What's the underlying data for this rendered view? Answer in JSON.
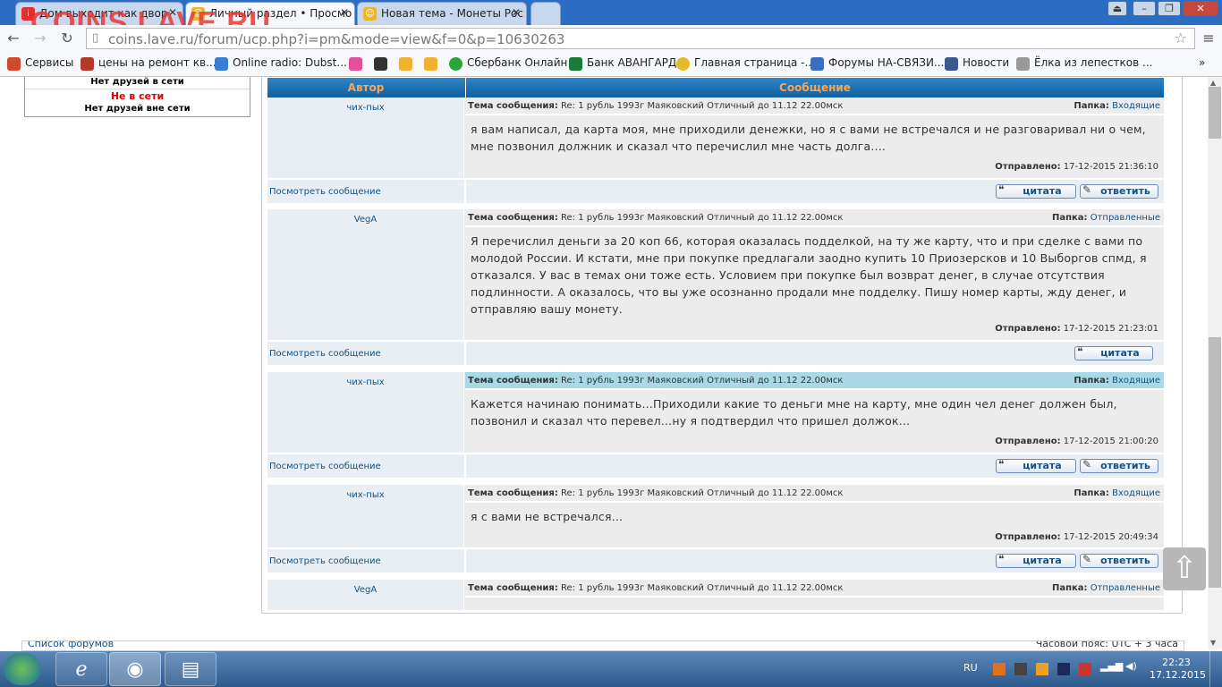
{
  "tabs": [
    {
      "title": "Дом выходит как двор",
      "fav": "i",
      "color": "#e03030"
    },
    {
      "title": "Личный раздел • Просмо",
      "fav": "☺",
      "color": "#e8b82b"
    },
    {
      "title": "Новая тема - Монеты Рос",
      "fav": "☺",
      "color": "#e8b82b"
    }
  ],
  "watermark": "COINS.LAVE.RU",
  "address_bar": {
    "url": "coins.lave.ru/forum/ucp.php?i=pm&mode=view&f=0&p=10630263"
  },
  "bookmarks": [
    {
      "label": "Сервисы",
      "color": "#d04a2a"
    },
    {
      "label": "цены на ремонт кв...",
      "color": "#b43a2a"
    },
    {
      "label": "Online radio: Dubst...",
      "color": "#3a7ed0"
    },
    {
      "label": "",
      "color": "#e34f9a"
    },
    {
      "label": "",
      "color": "#333333"
    },
    {
      "label": "",
      "color": "#f0b030"
    },
    {
      "label": "",
      "color": "#f0b030"
    },
    {
      "label": "Сбербанк Онлайн",
      "color": "#2ba53a"
    },
    {
      "label": "Банк АВАНГАРД",
      "color": "#1a7a3a"
    },
    {
      "label": "Главная страница -...",
      "color": "#e8b82b"
    },
    {
      "label": "Форумы НА-СВЯЗИ...",
      "color": "#3a6ec0"
    },
    {
      "label": "Новости",
      "color": "#3a5a90"
    },
    {
      "label": "Ёлка из лепестков ...",
      "color": "#999999"
    }
  ],
  "friends": {
    "online_none": "Нет друзей в сети",
    "offline_title": "Не в сети",
    "offline_none": "Нет друзей вне сети"
  },
  "table_header": {
    "author": "Автор",
    "message": "Сообщение"
  },
  "messages": [
    {
      "author": "чих-пых",
      "subject_label": "Тема сообщения:",
      "subject": "Re: 1 рубль 1993г Маяковский Отличный до 11.12 22.00мск",
      "folder_label": "Папка:",
      "folder": "Входящие",
      "text": "я вам написал, да карта моя, мне приходили денежки, но я с вами не встречался и не разговаривал ни о чем, мне позвонил должник и сказал что перечислил мне часть долга....",
      "sent_label": "Отправлено:",
      "sent": "17-12-2015 21:36:10",
      "view": "Посмотреть сообщение",
      "quote": "цитата",
      "reply": "ответить"
    },
    {
      "author": "VegA",
      "subject_label": "Тема сообщения:",
      "subject": "Re: 1 рубль 1993г Маяковский Отличный до 11.12 22.00мск",
      "folder_label": "Папка:",
      "folder": "Отправленные",
      "text": "Я перечислил деньги за 20 коп 66, которая оказалась подделкой, на ту же карту, что и при сделке с вами по молодой России. И кстати, мне при покупке предлагали заодно купить 10 Приозерсков и 10 Выборгов спмд, я отказался. У вас в темах они тоже есть. Условием при покупке был возврат денег, в случае отсутствия подлинности. А оказалось, что вы уже осознанно продали мне подделку. Пишу номер карты, жду денег, и отправляю вашу монету.",
      "sent_label": "Отправлено:",
      "sent": "17-12-2015 21:23:01",
      "view": "Посмотреть сообщение",
      "quote": "цитата"
    },
    {
      "author": "чих-пых",
      "subject_label": "Тема сообщения:",
      "subject": "Re: 1 рубль 1993г Маяковский Отличный до 11.12 22.00мск",
      "folder_label": "Папка:",
      "folder": "Входящие",
      "text": "Кажется начинаю понимать...Приходили какие то деньги мне на карту, мне один чел денег должен был, позвонил и сказал что перевел...ну я подтвердил что пришел должок...",
      "sent_label": "Отправлено:",
      "sent": "17-12-2015 21:00:20",
      "view": "Посмотреть сообщение",
      "quote": "цитата",
      "reply": "ответить"
    },
    {
      "author": "чих-пых",
      "subject_label": "Тема сообщения:",
      "subject": "Re: 1 рубль 1993г Маяковский Отличный до 11.12 22.00мск",
      "folder_label": "Папка:",
      "folder": "Входящие",
      "text": "я с вами не встречался...",
      "sent_label": "Отправлено:",
      "sent": "17-12-2015 20:49:34",
      "view": "Посмотреть сообщение",
      "quote": "цитата",
      "reply": "ответить"
    },
    {
      "author": "VegA",
      "subject_label": "Тема сообщения:",
      "subject": "Re: 1 рубль 1993г Маяковский Отличный до 11.12 22.00мск",
      "folder_label": "Папка:",
      "folder": "Отправленные"
    }
  ],
  "bottom_bar": {
    "left": "Список форумов",
    "right": "Часовой пояс: UTC + 3 часа"
  },
  "taskbar": {
    "lang": "RU",
    "time": "22:23",
    "date": "17.12.2015"
  }
}
